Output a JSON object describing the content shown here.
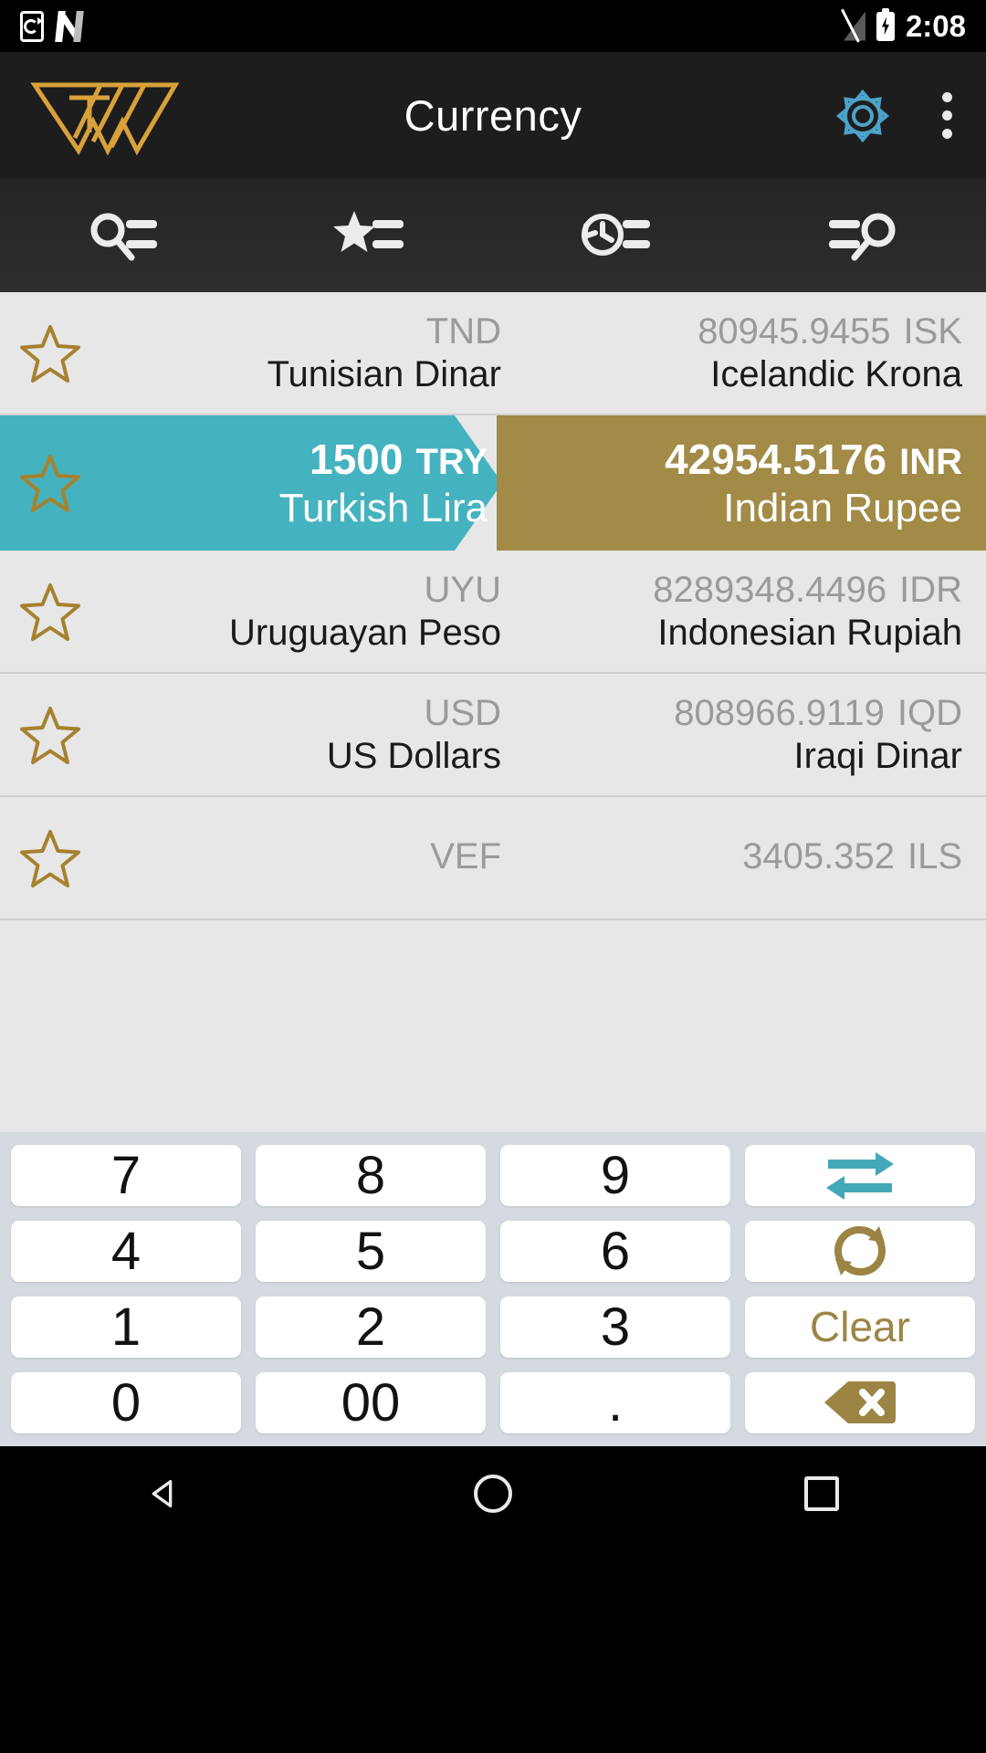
{
  "statusbar": {
    "time": "2:08",
    "icons": [
      "cast-icon",
      "netflix-icon",
      "signal-off-icon",
      "battery-charging-icon"
    ]
  },
  "appbar": {
    "title": "Currency",
    "logo_alt": "tw-logo",
    "settings_icon": "gear-icon",
    "overflow_icon": "kebab-menu-icon",
    "accent_gold": "#d19c34",
    "accent_teal": "#4ba3c7"
  },
  "tabs": [
    {
      "name": "tab-search-list",
      "icon": "search-list-icon"
    },
    {
      "name": "tab-favorites",
      "icon": "star-list-icon"
    },
    {
      "name": "tab-history",
      "icon": "history-list-icon"
    },
    {
      "name": "tab-list-search",
      "icon": "list-search-icon"
    }
  ],
  "list": {
    "star_icon": "star-outline-icon",
    "rows": [
      {
        "selected": false,
        "from_code": "TND",
        "from_name": "Tunisian Dinar",
        "from_amount": "",
        "to_amount": "80945.9455",
        "to_code": "ISK",
        "to_name": "Icelandic Krona"
      },
      {
        "selected": true,
        "from_amount": "1500",
        "from_code": "TRY",
        "from_name": "Turkish Lira",
        "to_amount": "42954.5176",
        "to_code": "INR",
        "to_name": "Indian Rupee"
      },
      {
        "selected": false,
        "from_code": "UYU",
        "from_name": "Uruguayan Peso",
        "from_amount": "",
        "to_amount": "8289348.4496",
        "to_code": "IDR",
        "to_name": "Indonesian Rupiah"
      },
      {
        "selected": false,
        "from_code": "USD",
        "from_name": "US Dollars",
        "from_amount": "",
        "to_amount": "808966.9119",
        "to_code": "IQD",
        "to_name": "Iraqi Dinar"
      },
      {
        "selected": false,
        "partial": true,
        "from_code": "VEF",
        "from_name": "",
        "from_amount": "",
        "to_amount": "3405.352",
        "to_code": "ILS",
        "to_name": ""
      }
    ],
    "selected_colors": {
      "from_bg": "#45b2bf",
      "to_bg": "#a18b47"
    }
  },
  "keypad": {
    "keys": [
      {
        "label": "7",
        "name": "key-7",
        "type": "digit"
      },
      {
        "label": "8",
        "name": "key-8",
        "type": "digit"
      },
      {
        "label": "9",
        "name": "key-9",
        "type": "digit"
      },
      {
        "label": "",
        "name": "swap-button",
        "type": "icon",
        "icon": "swap-arrows-icon"
      },
      {
        "label": "4",
        "name": "key-4",
        "type": "digit"
      },
      {
        "label": "5",
        "name": "key-5",
        "type": "digit"
      },
      {
        "label": "6",
        "name": "key-6",
        "type": "digit"
      },
      {
        "label": "",
        "name": "refresh-button",
        "type": "icon",
        "icon": "refresh-icon"
      },
      {
        "label": "1",
        "name": "key-1",
        "type": "digit"
      },
      {
        "label": "2",
        "name": "key-2",
        "type": "digit"
      },
      {
        "label": "3",
        "name": "key-3",
        "type": "digit"
      },
      {
        "label": "Clear",
        "name": "clear-button",
        "type": "text-gold"
      },
      {
        "label": "0",
        "name": "key-0",
        "type": "digit"
      },
      {
        "label": "00",
        "name": "key-00",
        "type": "digit"
      },
      {
        "label": ".",
        "name": "key-decimal",
        "type": "digit"
      },
      {
        "label": "",
        "name": "backspace-button",
        "type": "icon",
        "icon": "backspace-icon"
      }
    ]
  },
  "navbar": {
    "items": [
      {
        "name": "nav-back-button",
        "icon": "triangle-back-icon"
      },
      {
        "name": "nav-home-button",
        "icon": "circle-home-icon"
      },
      {
        "name": "nav-recents-button",
        "icon": "square-recents-icon"
      }
    ]
  }
}
